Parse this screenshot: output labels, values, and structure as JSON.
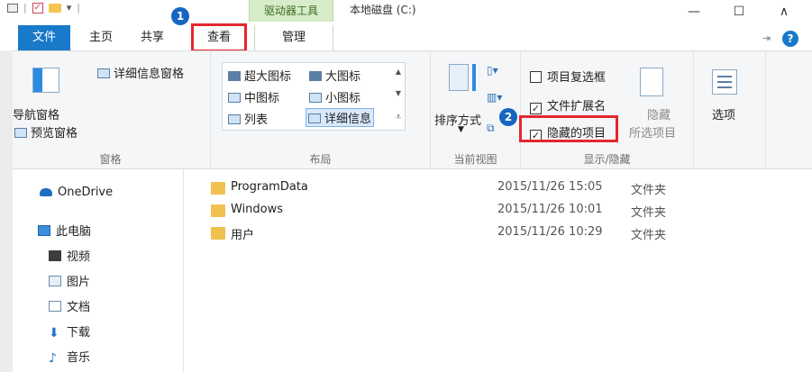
{
  "title_bar": {
    "context_tab_group": "驱动器工具",
    "window_title": "本地磁盘 (C:)",
    "minimize": "—",
    "maximize": "☐",
    "expand": "∧"
  },
  "tabs": {
    "file": "文件",
    "home": "主页",
    "share": "共享",
    "view": "查看",
    "manage": "管理"
  },
  "badges": {
    "one": "1",
    "two": "2"
  },
  "ribbon": {
    "panes": {
      "details_pane": "详细信息窗格",
      "navigation_pane": "导航窗格",
      "preview_pane": "预览窗格",
      "label": "窗格"
    },
    "layout": {
      "extra_large": "超大图标",
      "large": "大图标",
      "medium": "中图标",
      "small": "小图标",
      "list": "列表",
      "details": "详细信息",
      "label": "布局"
    },
    "current_view": {
      "sort_by": "排序方式",
      "label": "当前视图"
    },
    "show_hide": {
      "item_checkboxes": "项目复选框",
      "file_extensions": "文件扩展名",
      "hidden_items": "隐藏的项目",
      "hide_selected_line1": "隐藏",
      "hide_selected_line2": "所选项目",
      "label": "显示/隐藏",
      "item_checkboxes_checked": false,
      "file_extensions_checked": true,
      "hidden_items_checked": true
    },
    "options": "选项"
  },
  "nav": {
    "onedrive": "OneDrive",
    "this_pc": "此电脑",
    "videos": "视频",
    "pictures": "图片",
    "documents": "文档",
    "downloads": "下载",
    "music": "音乐"
  },
  "files": [
    {
      "name": "ProgramData",
      "date": "2015/11/26 15:05",
      "type": "文件夹"
    },
    {
      "name": "Windows",
      "date": "2015/11/26 10:01",
      "type": "文件夹"
    },
    {
      "name": "用户",
      "date": "2015/11/26 10:29",
      "type": "文件夹"
    }
  ],
  "colors": {
    "accent": "#1979ca",
    "highlight_box": "#e5262d",
    "badge": "#1665c0",
    "folder": "#f1c14f"
  }
}
